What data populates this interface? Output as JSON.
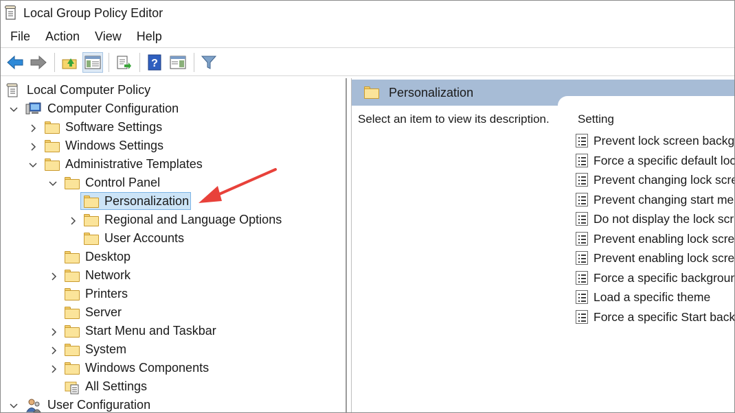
{
  "window": {
    "title": "Local Group Policy Editor"
  },
  "menu": [
    "File",
    "Action",
    "View",
    "Help"
  ],
  "toolbar": {
    "buttons": [
      "back-icon",
      "forward-icon",
      "up-folder-icon",
      "show-hide-tree-icon",
      "export-list-icon",
      "help-icon",
      "show-action-pane-icon",
      "filter-icon"
    ]
  },
  "tree": {
    "root": "Local Computer Policy",
    "computer_configuration": "Computer Configuration",
    "software_settings": "Software Settings",
    "windows_settings": "Windows Settings",
    "administrative_templates": "Administrative Templates",
    "control_panel": "Control Panel",
    "personalization": "Personalization",
    "regional_language": "Regional and Language Options",
    "user_accounts": "User Accounts",
    "desktop": "Desktop",
    "network": "Network",
    "printers": "Printers",
    "server": "Server",
    "start_menu": "Start Menu and Taskbar",
    "system": "System",
    "windows_components": "Windows Components",
    "all_settings": "All Settings",
    "user_configuration": "User Configuration"
  },
  "right": {
    "header_title": "Personalization",
    "description": "Select an item to view its description.",
    "setting_column": "Setting",
    "settings": [
      "Prevent lock screen backgr",
      "Force a specific default loc",
      "Prevent changing lock scre",
      "Prevent changing start me",
      "Do not display the lock scr",
      "Prevent enabling lock scree",
      "Prevent enabling lock scree",
      "Force a specific backgroun",
      "Load a specific theme",
      "Force a specific Start backg"
    ]
  },
  "colors": {
    "selection": "#cce4f7",
    "header_band": "#a7bcd6",
    "arrow": "#e8413a",
    "folder": "#fbe49a"
  }
}
